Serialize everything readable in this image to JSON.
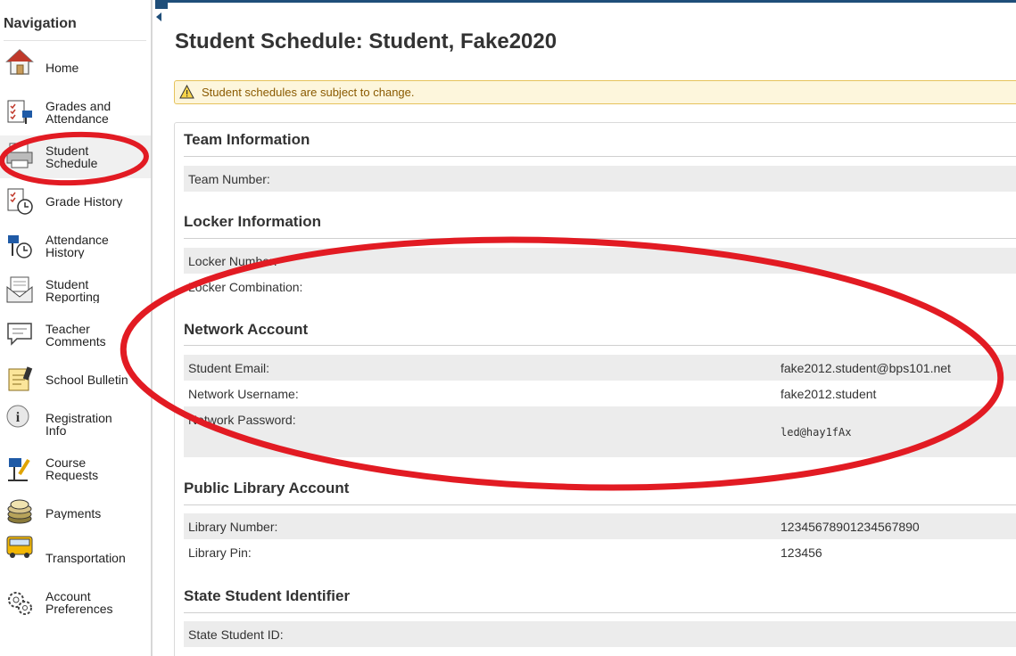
{
  "sidebar": {
    "title": "Navigation",
    "items": [
      {
        "label": "Home",
        "icon": "home-icon"
      },
      {
        "label": "Grades and\nAttendance",
        "icon": "grades-attendance-icon"
      },
      {
        "label": "Student\nSchedule",
        "icon": "schedule-printer-icon"
      },
      {
        "label": "Grade History",
        "icon": "grade-history-icon"
      },
      {
        "label": "Attendance\nHistory",
        "icon": "attendance-history-icon"
      },
      {
        "label": "Student\nReporting",
        "icon": "envelope-icon"
      },
      {
        "label": "Teacher\nComments",
        "icon": "comment-icon"
      },
      {
        "label": "School Bulletin",
        "icon": "bulletin-icon"
      },
      {
        "label": "Registration\nInfo",
        "icon": "info-icon"
      },
      {
        "label": "Course\nRequests",
        "icon": "course-request-icon"
      },
      {
        "label": "Payments",
        "icon": "coins-icon"
      },
      {
        "label": "Transportation",
        "icon": "bus-icon"
      },
      {
        "label": "Account\nPreferences",
        "icon": "gears-icon"
      }
    ]
  },
  "page": {
    "title": "Student Schedule: Student, Fake2020",
    "alert": "Student schedules are subject to change."
  },
  "sections": {
    "team": {
      "title": "Team Information",
      "rows": [
        {
          "label": "Team Number:",
          "value": ""
        }
      ]
    },
    "locker": {
      "title": "Locker Information",
      "rows": [
        {
          "label": "Locker Number:",
          "value": ""
        },
        {
          "label": "Locker Combination:",
          "value": ""
        }
      ]
    },
    "network": {
      "title": "Network Account",
      "rows": [
        {
          "label": "Student Email:",
          "value": "fake2012.student@bps101.net"
        },
        {
          "label": "Network Username:",
          "value": "fake2012.student"
        },
        {
          "label": "Network Password:",
          "value": "led@hay1fAx"
        }
      ]
    },
    "library": {
      "title": "Public Library Account",
      "rows": [
        {
          "label": "Library Number:",
          "value": "12345678901234567890"
        },
        {
          "label": "Library Pin:",
          "value": "123456"
        }
      ]
    },
    "state": {
      "title": "State Student Identifier",
      "rows": [
        {
          "label": "State Student ID:",
          "value": ""
        }
      ]
    }
  },
  "colors": {
    "accent": "#1f4e79",
    "alert_bg": "#fdf6dc",
    "alert_border": "#e6c35c",
    "alert_text": "#8a5a00",
    "row_shade": "#ececec",
    "annotation_red": "#e21b23"
  }
}
